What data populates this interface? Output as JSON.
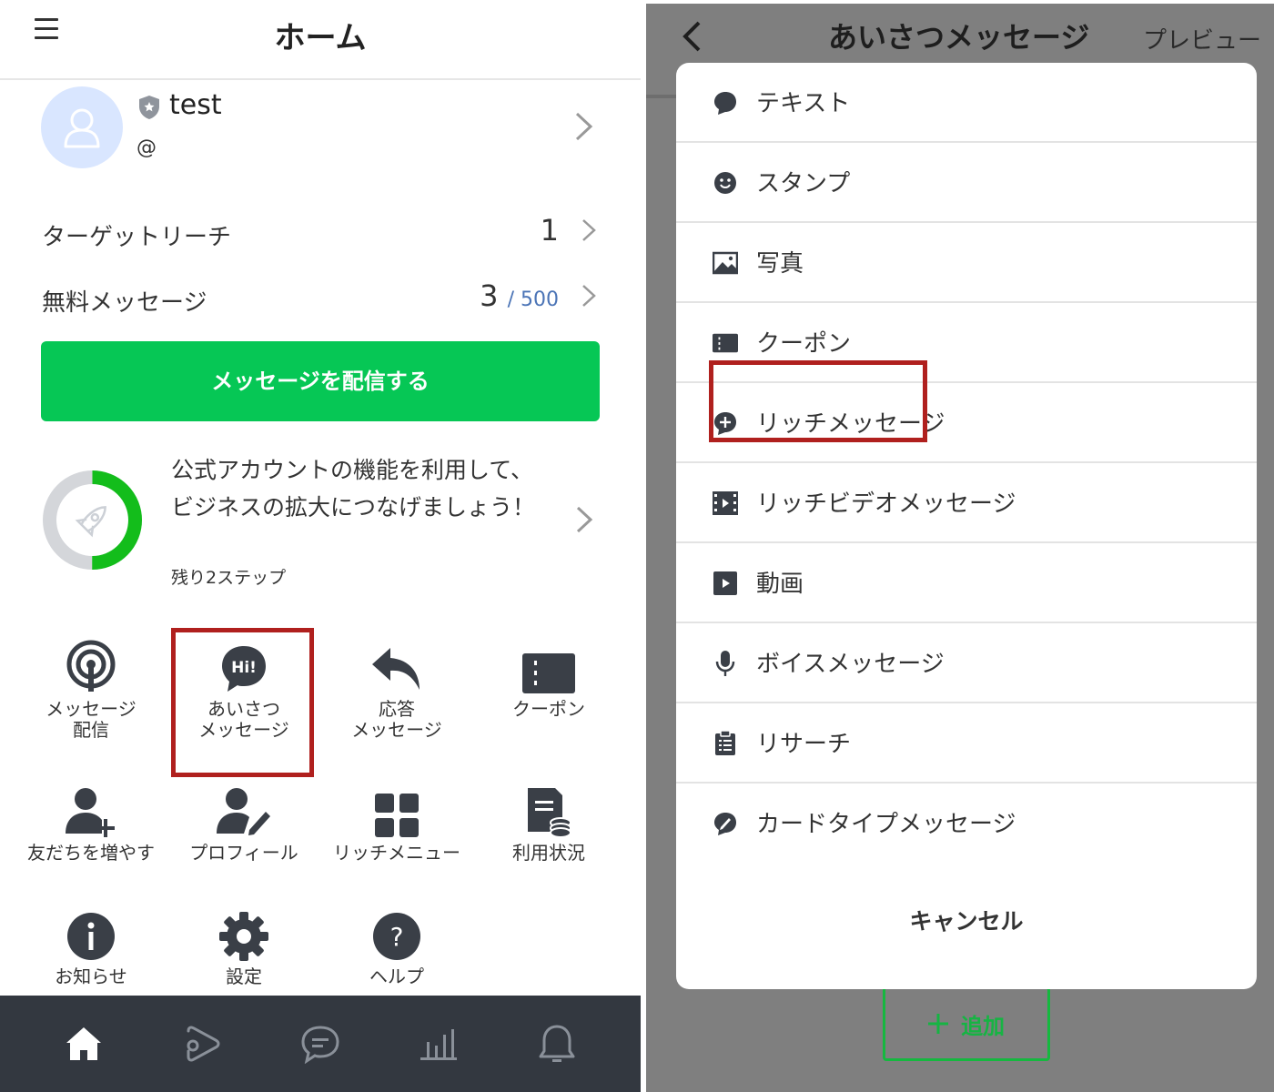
{
  "left": {
    "header": {
      "title": "ホーム"
    },
    "profile": {
      "name": "test",
      "id": "@"
    },
    "stats": [
      {
        "label": "ターゲットリーチ",
        "value": "1",
        "max": ""
      },
      {
        "label": "無料メッセージ",
        "value": "3",
        "max": "/ 500"
      }
    ],
    "send_button": "メッセージを配信する",
    "promo": {
      "text": "公式アカウントの機能を利用して、ビジネスの拡大につなげましょう！",
      "sub": "残り2ステップ",
      "progress": 0.5
    },
    "features": [
      {
        "label": "メッセージ\n配信",
        "icon": "broadcast-icon"
      },
      {
        "label": "あいさつ\nメッセージ",
        "icon": "hi-bubble-icon"
      },
      {
        "label": "応答\nメッセージ",
        "icon": "reply-arrow-icon"
      },
      {
        "label": "クーポン",
        "icon": "coupon-icon"
      },
      {
        "label": "友だちを増やす",
        "icon": "add-friend-icon"
      },
      {
        "label": "プロフィール",
        "icon": "profile-edit-icon"
      },
      {
        "label": "リッチメニュー",
        "icon": "grid-icon"
      },
      {
        "label": "利用状況",
        "icon": "usage-doc-icon"
      },
      {
        "label": "お知らせ",
        "icon": "info-icon"
      },
      {
        "label": "設定",
        "icon": "gear-icon"
      },
      {
        "label": "ヘルプ",
        "icon": "help-icon"
      }
    ],
    "bottom_nav": [
      "home-icon",
      "voom-icon",
      "chat-icon",
      "stats-icon",
      "bell-icon"
    ],
    "colors": {
      "accent_green": "#06c755",
      "highlight_red": "#b0201e",
      "nav_bg": "#333840"
    }
  },
  "right": {
    "header": {
      "title": "あいさつメッセージ",
      "preview": "プレビュー"
    },
    "menu": [
      {
        "label": "テキスト",
        "icon": "text-bubble-icon"
      },
      {
        "label": "スタンプ",
        "icon": "sticker-icon"
      },
      {
        "label": "写真",
        "icon": "photo-icon"
      },
      {
        "label": "クーポン",
        "icon": "coupon-icon"
      },
      {
        "label": "リッチメッセージ",
        "icon": "rich-message-icon"
      },
      {
        "label": "リッチビデオメッセージ",
        "icon": "rich-video-icon"
      },
      {
        "label": "動画",
        "icon": "video-icon"
      },
      {
        "label": "ボイスメッセージ",
        "icon": "mic-icon"
      },
      {
        "label": "リサーチ",
        "icon": "clipboard-icon"
      },
      {
        "label": "カードタイプメッセージ",
        "icon": "card-message-icon"
      }
    ],
    "cancel": "キャンセル",
    "add_button": "追加"
  }
}
